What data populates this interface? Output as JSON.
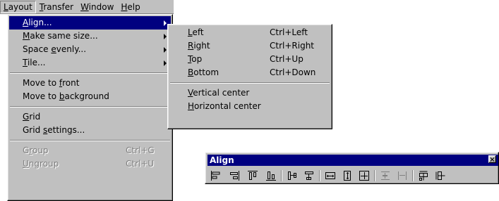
{
  "menubar": {
    "items": [
      {
        "label": "Layout",
        "ul": "L",
        "rest": "ayout"
      },
      {
        "label": "Transfer",
        "ul": "T",
        "rest": "ransfer"
      },
      {
        "label": "Window",
        "ul": "W",
        "rest": "indow"
      },
      {
        "label": "Help",
        "ul": "H",
        "rest": "elp"
      }
    ]
  },
  "layout_menu": {
    "align": {
      "pre": "",
      "ul": "A",
      "post": "lign..."
    },
    "make_same_size": {
      "pre": "",
      "ul": "M",
      "post": "ake same size..."
    },
    "space_evenly": {
      "pre": "Space ",
      "ul": "e",
      "post": "venly..."
    },
    "tile": {
      "pre": "",
      "ul": "T",
      "post": "ile..."
    },
    "move_to_front": {
      "pre": "Move to ",
      "ul": "f",
      "post": "ront"
    },
    "move_to_background": {
      "pre": "Move to ",
      "ul": "b",
      "post": "ackground"
    },
    "grid": {
      "pre": "",
      "ul": "G",
      "post": "rid"
    },
    "grid_settings": {
      "pre": "Grid ",
      "ul": "s",
      "post": "ettings..."
    },
    "group": {
      "pre": "G",
      "ul": "r",
      "post": "oup",
      "accel": "Ctrl+G"
    },
    "ungroup": {
      "pre": "",
      "ul": "U",
      "post": "ngroup",
      "accel": "Ctrl+U"
    }
  },
  "align_submenu": {
    "left": {
      "ul": "L",
      "post": "eft",
      "accel": "Ctrl+Left"
    },
    "right": {
      "ul": "R",
      "post": "ight",
      "accel": "Ctrl+Right"
    },
    "top": {
      "ul": "T",
      "post": "op",
      "accel": "Ctrl+Up"
    },
    "bottom": {
      "ul": "B",
      "post": "ottom",
      "accel": "Ctrl+Down"
    },
    "vertical_center": {
      "ul": "V",
      "post": "ertical center"
    },
    "horizontal_center": {
      "ul": "H",
      "post": "orizontal center"
    }
  },
  "toolbar": {
    "title": "Align",
    "close": "×",
    "buttons": [
      "align-left-icon",
      "align-right-icon",
      "align-top-icon",
      "align-bottom-icon",
      "align-vertical-center-icon",
      "align-horizontal-center-icon",
      "same-width-icon",
      "same-height-icon",
      "same-size-icon",
      "space-evenly-vertical-icon",
      "space-evenly-horizontal-icon",
      "tile-vertical-icon",
      "tile-horizontal-icon"
    ]
  }
}
